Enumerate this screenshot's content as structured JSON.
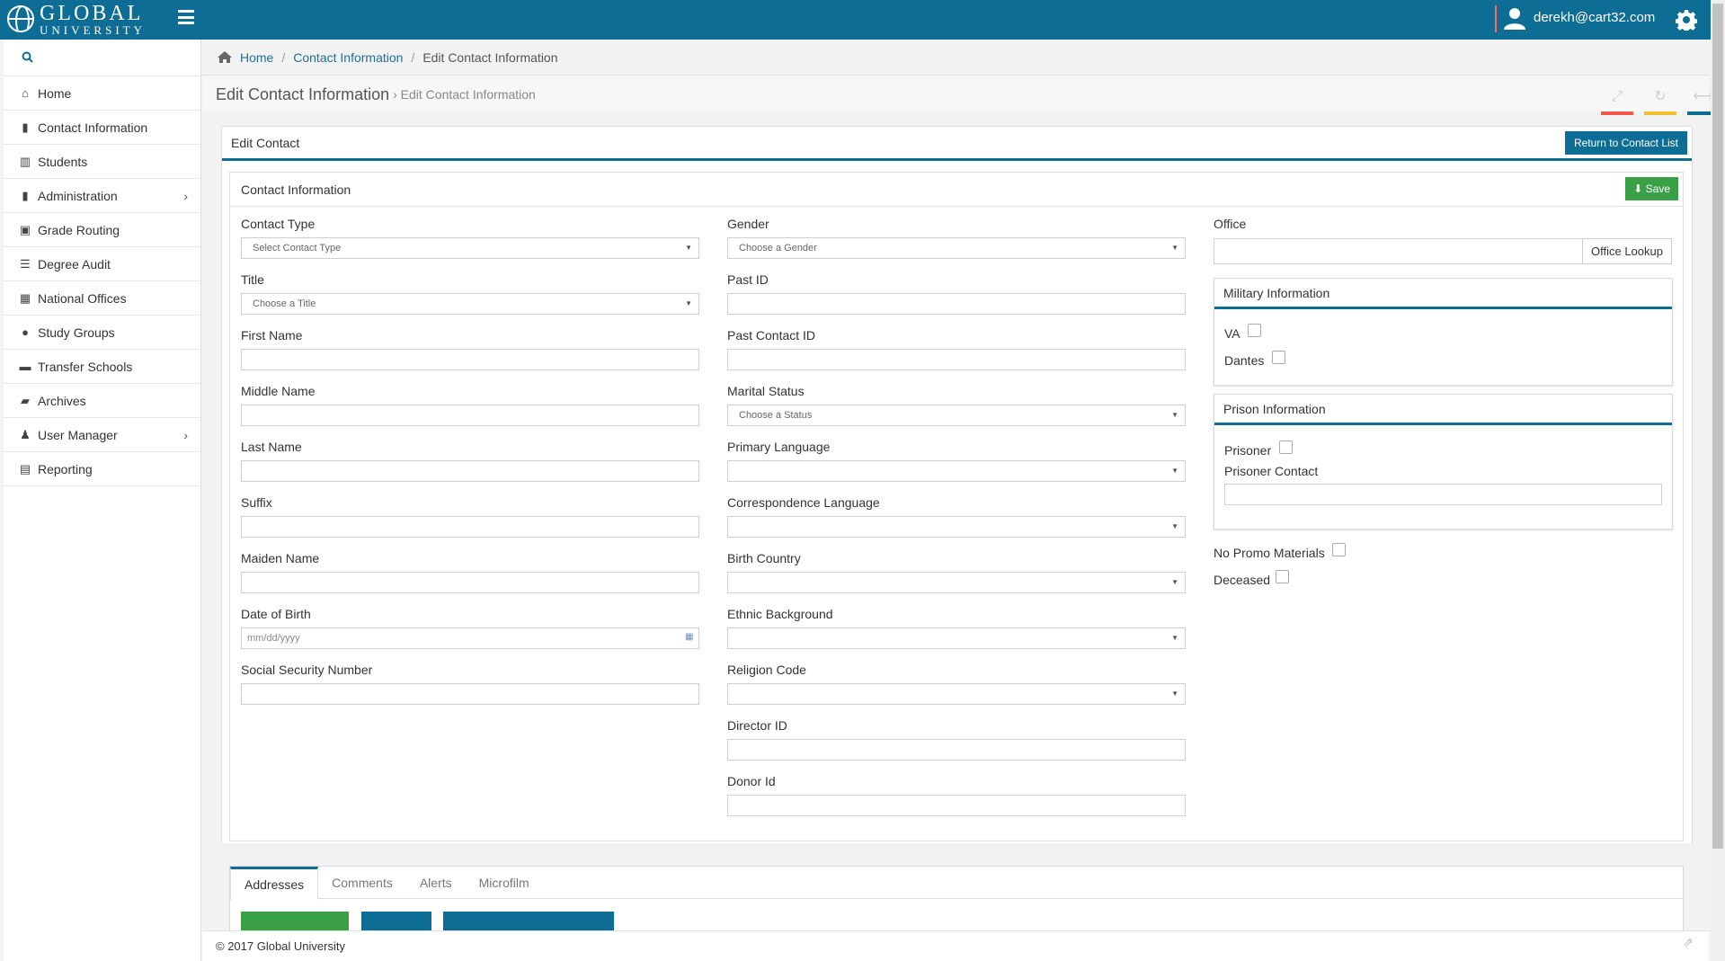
{
  "app": {
    "logo_line1": "GLOBAL",
    "logo_line2": "UNIVERSITY",
    "user_email": "derekh@cart32.com"
  },
  "sidebar": {
    "items": [
      {
        "label": "Home",
        "icon": "home-icon"
      },
      {
        "label": "Contact Information",
        "icon": "book-icon"
      },
      {
        "label": "Students",
        "icon": "institution-icon"
      },
      {
        "label": "Administration",
        "icon": "book-icon",
        "has_submenu": true
      },
      {
        "label": "Grade Routing",
        "icon": "inbox-icon"
      },
      {
        "label": "Degree Audit",
        "icon": "list-icon"
      },
      {
        "label": "National Offices",
        "icon": "building-icon"
      },
      {
        "label": "Study Groups",
        "icon": "users-icon"
      },
      {
        "label": "Transfer Schools",
        "icon": "briefcase-icon"
      },
      {
        "label": "Archives",
        "icon": "folder-icon"
      },
      {
        "label": "User Manager",
        "icon": "user-icon",
        "has_submenu": true
      },
      {
        "label": "Reporting",
        "icon": "file-icon"
      }
    ]
  },
  "breadcrumb": {
    "home": "Home",
    "level1": "Contact Information",
    "current": "Edit Contact Information"
  },
  "page": {
    "title": "Edit Contact Information",
    "subtitle": "› Edit Contact Information"
  },
  "edit_card": {
    "title": "Edit Contact",
    "return_button": "Return to Contact List"
  },
  "contact_card": {
    "title": "Contact Information",
    "save_button": "Save"
  },
  "fields": {
    "contact_type": {
      "label": "Contact Type",
      "value": "Select Contact Type"
    },
    "title": {
      "label": "Title",
      "value": "Choose a Title"
    },
    "first_name": {
      "label": "First Name",
      "value": ""
    },
    "middle_name": {
      "label": "Middle Name",
      "value": ""
    },
    "last_name": {
      "label": "Last Name",
      "value": ""
    },
    "suffix": {
      "label": "Suffix",
      "value": ""
    },
    "maiden_name": {
      "label": "Maiden Name",
      "value": ""
    },
    "date_of_birth": {
      "label": "Date of Birth",
      "placeholder": "mm/dd/yyyy"
    },
    "ssn": {
      "label": "Social Security Number",
      "value": ""
    },
    "gender": {
      "label": "Gender",
      "value": "Choose a Gender"
    },
    "past_id": {
      "label": "Past ID",
      "value": ""
    },
    "past_contact_id": {
      "label": "Past Contact ID",
      "value": ""
    },
    "marital_status": {
      "label": "Marital Status",
      "value": "Choose a Status"
    },
    "primary_language": {
      "label": "Primary Language",
      "value": ""
    },
    "correspondence_language": {
      "label": "Correspondence Language",
      "value": ""
    },
    "birth_country": {
      "label": "Birth Country",
      "value": ""
    },
    "ethnic_background": {
      "label": "Ethnic Background",
      "value": ""
    },
    "religion_code": {
      "label": "Religion Code",
      "value": ""
    },
    "director_id": {
      "label": "Director ID",
      "value": ""
    },
    "donor_id": {
      "label": "Donor Id",
      "value": ""
    },
    "office": {
      "label": "Office",
      "value": "",
      "lookup_button": "Office Lookup"
    }
  },
  "military": {
    "title": "Military Information",
    "va_label": "VA",
    "dantes_label": "Dantes"
  },
  "prison": {
    "title": "Prison Information",
    "prisoner_label": "Prisoner",
    "prisoner_contact_label": "Prisoner Contact"
  },
  "extra": {
    "no_promo_label": "No Promo Materials",
    "deceased_label": "Deceased"
  },
  "tabs": [
    "Addresses",
    "Comments",
    "Alerts",
    "Microfilm"
  ],
  "footer": {
    "text": "© 2017 Global University"
  },
  "colors": {
    "brand": "#0e6d94",
    "save": "#3aa047",
    "tool_bar_red": "#f05a46",
    "tool_bar_yellow": "#f3c033",
    "tool_bar_blue": "#0e6d94"
  }
}
